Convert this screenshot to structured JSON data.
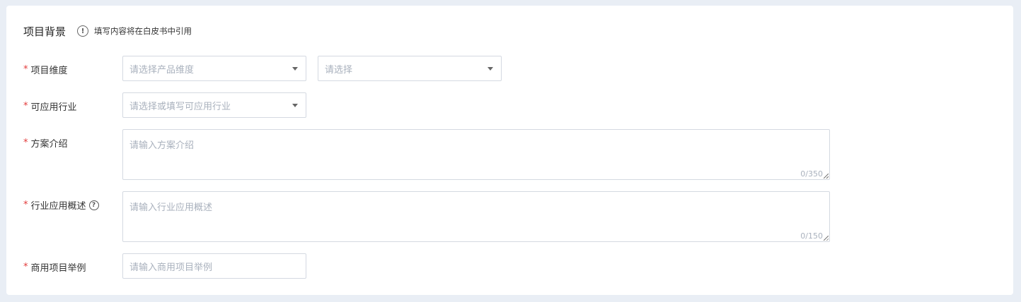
{
  "section": {
    "title": "项目背景",
    "hint": "填写内容将在白皮书中引用",
    "info_icon": "!"
  },
  "fields": {
    "dimension": {
      "required_mark": "*",
      "label": "项目维度",
      "select1_placeholder": "请选择产品维度",
      "select2_placeholder": "请选择"
    },
    "industry": {
      "required_mark": "*",
      "label": "可应用行业",
      "placeholder": "请选择或填写可应用行业"
    },
    "intro": {
      "required_mark": "*",
      "label": "方案介绍",
      "placeholder": "请输入方案介绍",
      "counter": "0/350"
    },
    "overview": {
      "required_mark": "*",
      "label": "行业应用概述",
      "help_icon": "?",
      "placeholder": "请输入行业应用概述",
      "counter": "0/150"
    },
    "example": {
      "required_mark": "*",
      "label": "商用项目举例",
      "placeholder": "请输入商用项目举例"
    }
  },
  "colors": {
    "required": "#e23b3b",
    "border": "#d4d9e1",
    "placeholder": "#a9b1bd",
    "page_bg": "#e9eef5"
  }
}
